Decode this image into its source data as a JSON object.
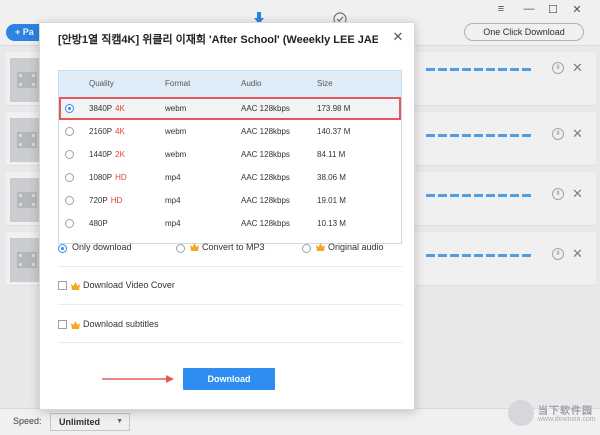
{
  "header": {
    "paste_label": "+ Pa",
    "one_click_label": "One Click Download",
    "download_tab_icon": "download-arrow-icon",
    "finished_tab_icon": "check-circle-icon",
    "window_controls": [
      "menu-icon",
      "minimize-icon",
      "maximize-icon",
      "close-icon"
    ]
  },
  "rows": [
    {
      "id": 1
    },
    {
      "id": 2
    },
    {
      "id": 3
    },
    {
      "id": 4
    }
  ],
  "statusbar": {
    "speed_label": "Speed:",
    "speed_value": "Unlimited"
  },
  "watermark": {
    "text": "当下软件园",
    "url": "www.downxia.com"
  },
  "modal": {
    "title": "[안방1열 직캠4K] 위클리 이재희 'After School' (Weeekly LEE JAE H",
    "close_icon": "close-icon",
    "columns": [
      "Quality",
      "Format",
      "Audio",
      "Size"
    ],
    "formats": [
      {
        "quality": "3840P",
        "badge": "4K",
        "format": "webm",
        "audio": "AAC 128kbps",
        "size": "173.98 M",
        "selected": true
      },
      {
        "quality": "2160P",
        "badge": "4K",
        "format": "webm",
        "audio": "AAC 128kbps",
        "size": "140.37 M",
        "selected": false
      },
      {
        "quality": "1440P",
        "badge": "2K",
        "format": "webm",
        "audio": "AAC 128kbps",
        "size": "84.11 M",
        "selected": false
      },
      {
        "quality": "1080P",
        "badge": "HD",
        "format": "mp4",
        "audio": "AAC 128kbps",
        "size": "38.06 M",
        "selected": false
      },
      {
        "quality": "720P",
        "badge": "HD",
        "format": "mp4",
        "audio": "AAC 128kbps",
        "size": "19.01 M",
        "selected": false
      },
      {
        "quality": "480P",
        "badge": "",
        "format": "mp4",
        "audio": "AAC 128kbps",
        "size": "10.13 M",
        "selected": false
      }
    ],
    "options": {
      "only_download": "Only download",
      "convert_mp3": "Convert to MP3",
      "original_audio": "Original audio",
      "selected": "only_download"
    },
    "download_cover_label": "Download Video Cover",
    "download_subtitles_label": "Download subtitles",
    "download_button_label": "Download",
    "accent_color": "#2f8cf0",
    "badge_color": "#e0453b",
    "highlight_color": "#e45a5a",
    "premium_icon": "crown-icon"
  }
}
